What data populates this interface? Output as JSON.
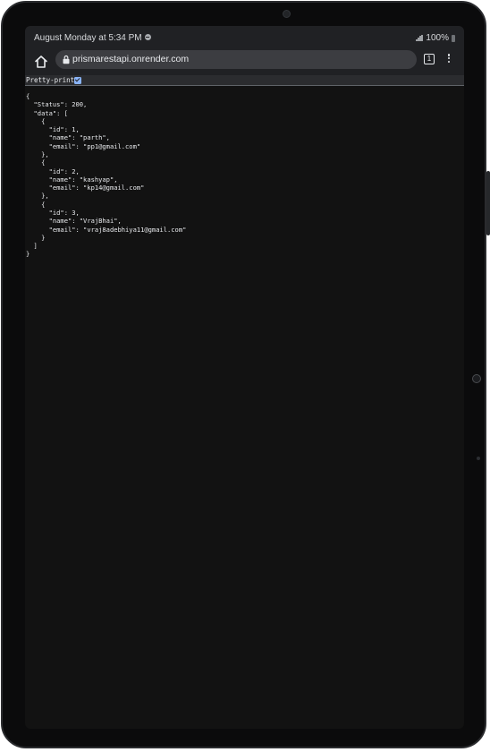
{
  "status_bar": {
    "time": "August Monday at 5:34 PM",
    "battery": "100%"
  },
  "browser": {
    "url": "prismarestapi.onrender.com",
    "tab_count": "1"
  },
  "json_viewer": {
    "pretty_print_label": "Pretty-print",
    "pretty_print_checked": true,
    "content": "{\n  \"Status\": 200,\n  \"data\": [\n    {\n      \"id\": 1,\n      \"name\": \"parth\",\n      \"email\": \"pp1@gmail.com\"\n    },\n    {\n      \"id\": 2,\n      \"name\": \"kashyap\",\n      \"email\": \"kp14@gmail.com\"\n    },\n    {\n      \"id\": 3,\n      \"name\": \"VrajBhai\",\n      \"email\": \"vraj8adebhiya11@gmail.com\"\n    }\n  ]\n}"
  },
  "colors": {
    "page_background": "#121212",
    "toolbar_background": "#202124",
    "url_bar_background": "#3c3d41",
    "checkbox_accent": "#8ab4f8"
  },
  "icons": {
    "home": "home-icon",
    "lock": "lock-icon",
    "tabs": "tab-switcher-icon",
    "menu": "more-vert-icon",
    "dnd": "do-not-disturb-icon",
    "signal": "signal-icon",
    "battery": "battery-icon"
  }
}
